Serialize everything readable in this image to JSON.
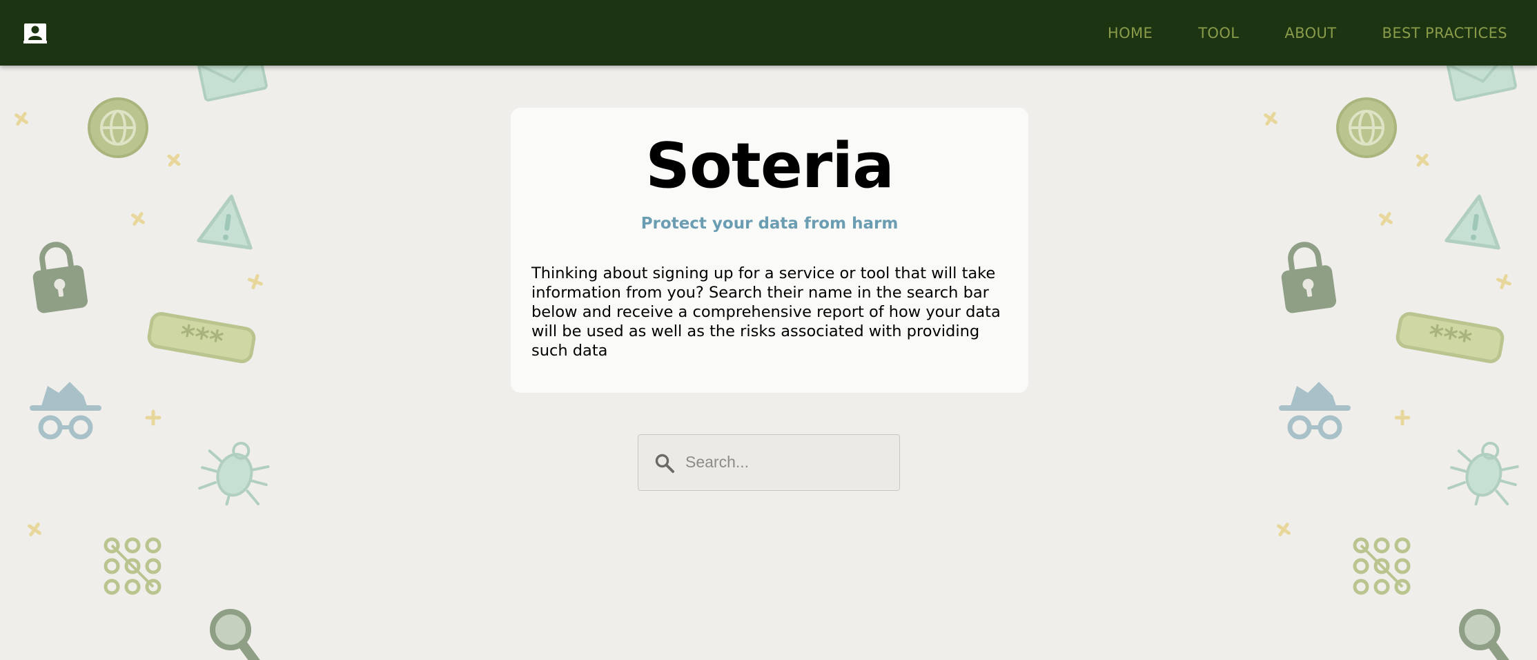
{
  "nav": {
    "logo_icon": "user-badge-icon",
    "links": [
      {
        "label": "HOME"
      },
      {
        "label": "TOOL"
      },
      {
        "label": "ABOUT"
      },
      {
        "label": "BEST PRACTICES"
      }
    ]
  },
  "hero": {
    "title": "Soteria",
    "subtitle": "Protect your data from harm",
    "description": "Thinking about signing up for a service or tool that will take information from you? Search their name in the search bar below and receive a comprehensive report of how your data will be used as well as the risks associated with providing such data"
  },
  "search": {
    "placeholder": "Search...",
    "value": "",
    "icon": "search-icon"
  },
  "background_icons": [
    "envelope-icon",
    "globe-icon",
    "warning-icon",
    "padlock-icon",
    "password-icon",
    "spy-icon",
    "bug-icon",
    "pattern-lock-icon",
    "magnifier-icon",
    "sparkle-icon"
  ],
  "colors": {
    "navbar": "#1c3412",
    "nav_link": "#8a9b4a",
    "background": "#f0eeeb",
    "card": "#fafaf8",
    "subtitle": "#6a9cb2"
  }
}
